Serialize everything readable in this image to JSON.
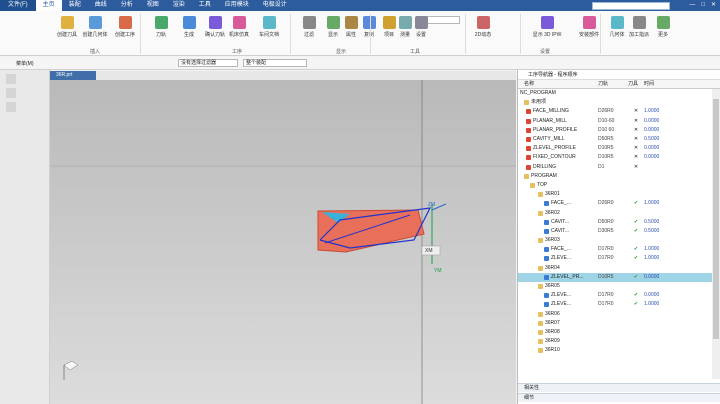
{
  "title_tabs": [
    {
      "label": "文件(F)"
    },
    {
      "label": "主页"
    },
    {
      "label": "装配"
    },
    {
      "label": "曲线"
    },
    {
      "label": "分析"
    },
    {
      "label": "视图"
    },
    {
      "label": "渲染"
    },
    {
      "label": "工具"
    },
    {
      "label": "应用模块"
    },
    {
      "label": "电极设计"
    }
  ],
  "ribbon": {
    "buttons": [
      "创建刀具",
      "创建几何体",
      "创建工序",
      "刀轨",
      "生成",
      "确认刀轨",
      "机床仿真",
      "车间文档",
      "过滤",
      "显示",
      "属性",
      "复制",
      "项目",
      "测量",
      "设置",
      "2D动态"
    ],
    "groups": [
      "插入",
      "工序",
      "显示",
      "工具",
      "设置"
    ],
    "combo_value": "5",
    "tail_buttons": [
      "显示 3D IPW",
      "安装部件",
      "几何体",
      "加工指派",
      "更多"
    ]
  },
  "toolbar2": {
    "menu": "菜单(M)",
    "filter": "没有选择过滤器",
    "scope": "整个装配"
  },
  "doc_tab": "36R.prt",
  "axes": {
    "zm": "ZM",
    "xm": "XM",
    "ym": "YM"
  },
  "panel": {
    "title": "工序导航器 - 程序顺序",
    "columns": [
      "名称",
      "刀轨",
      "刀具",
      "时间"
    ],
    "rows": [
      {
        "name": "NC_PROGRAM",
        "tool": "",
        "state": "",
        "time": ""
      },
      {
        "name": "未用项",
        "tool": "",
        "state": "",
        "time": ""
      },
      {
        "name": "FACE_MILLING",
        "tool": "D26R0",
        "state": "x",
        "time": "1.0000"
      },
      {
        "name": "PLANAR_MILL",
        "tool": "D10-60",
        "state": "x",
        "time": "0.0000"
      },
      {
        "name": "PLANAR_PROFILE",
        "tool": "D10 60",
        "state": "x",
        "time": "0.0000"
      },
      {
        "name": "CAVITY_MILL",
        "tool": "D50R5",
        "state": "x",
        "time": "0.5000"
      },
      {
        "name": "ZLEVEL_PROFILE",
        "tool": "D10R5",
        "state": "x",
        "time": "0.0000"
      },
      {
        "name": "FIXED_CONTOUR",
        "tool": "D10R5",
        "state": "x",
        "time": "0.0000"
      },
      {
        "name": "DRILLING",
        "tool": "D1",
        "state": "x",
        "time": ""
      },
      {
        "name": "PROGRAM",
        "tool": "",
        "state": "",
        "time": ""
      },
      {
        "name": "TOP",
        "tool": "",
        "state": "",
        "time": ""
      },
      {
        "name": "36R01",
        "tool": "",
        "state": "",
        "time": ""
      },
      {
        "name": "FACE_...",
        "tool": "D26R0",
        "state": "ok",
        "time": "1.0000"
      },
      {
        "name": "36R02",
        "tool": "",
        "state": "",
        "time": ""
      },
      {
        "name": "CAVIT...",
        "tool": "D50R0",
        "state": "ok",
        "time": "0.5000"
      },
      {
        "name": "CAVIT...",
        "tool": "D30R5",
        "state": "ok",
        "time": "0.5000"
      },
      {
        "name": "36R03",
        "tool": "",
        "state": "",
        "time": ""
      },
      {
        "name": "FACE_...",
        "tool": "D17R0",
        "state": "ok",
        "time": "1.0000"
      },
      {
        "name": "ZLEVE...",
        "tool": "D17R0",
        "state": "ok",
        "time": "1.0000"
      },
      {
        "name": "36R04",
        "tool": "",
        "state": "",
        "time": ""
      },
      {
        "name": "ZLEVEL_PR...",
        "tool": "D10R5",
        "state": "ok",
        "time": "0.0000"
      },
      {
        "name": "36R05",
        "tool": "",
        "state": "",
        "time": ""
      },
      {
        "name": "ZLEVE...",
        "tool": "D17R0",
        "state": "ok",
        "time": "0.0000"
      },
      {
        "name": "ZLEVE...",
        "tool": "D17R0",
        "state": "ok",
        "time": "1.0000"
      },
      {
        "name": "36R06",
        "tool": "",
        "state": "",
        "time": ""
      },
      {
        "name": "36R07",
        "tool": "",
        "state": "",
        "time": ""
      },
      {
        "name": "36R08",
        "tool": "",
        "state": "",
        "time": ""
      },
      {
        "name": "36R09",
        "tool": "",
        "state": "",
        "time": ""
      },
      {
        "name": "36R10",
        "tool": "",
        "state": "",
        "time": ""
      }
    ],
    "bottom1": "相关性",
    "bottom2": "细节"
  },
  "colors": {
    "accent": "#2d5c9e",
    "part": "#e8705a",
    "selected": "#9fd3e6"
  }
}
